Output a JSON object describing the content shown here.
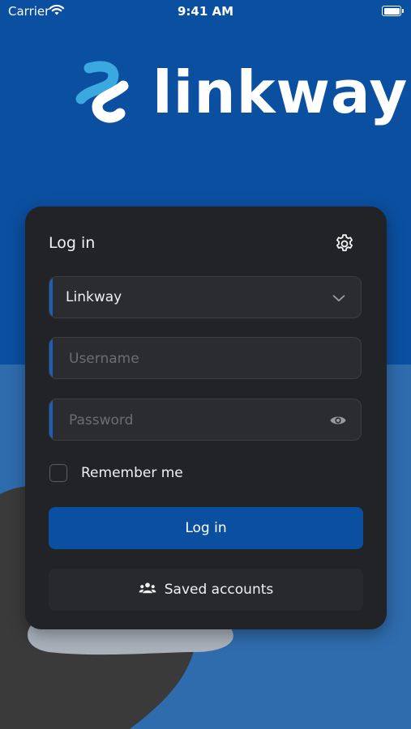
{
  "status_bar": {
    "carrier": "Carrier",
    "time": "9:41 AM"
  },
  "logo": {
    "text": "linkway"
  },
  "login_card": {
    "title": "Log in",
    "server_select": {
      "selected": "Linkway"
    },
    "username": {
      "value": "",
      "placeholder": "Username"
    },
    "password": {
      "value": "",
      "placeholder": "Password"
    },
    "remember_label": "Remember me",
    "remember_checked": false,
    "login_label": "Log in",
    "saved_accounts_label": "Saved accounts"
  },
  "colors": {
    "primary": "#0b4fa0",
    "background_lower": "#2f6cae",
    "card": "#222326",
    "logo_accent": "#39a9e0"
  },
  "icons": [
    "wifi-icon",
    "battery-icon",
    "gear-icon",
    "chevron-down-icon",
    "eye-icon",
    "people-icon"
  ]
}
